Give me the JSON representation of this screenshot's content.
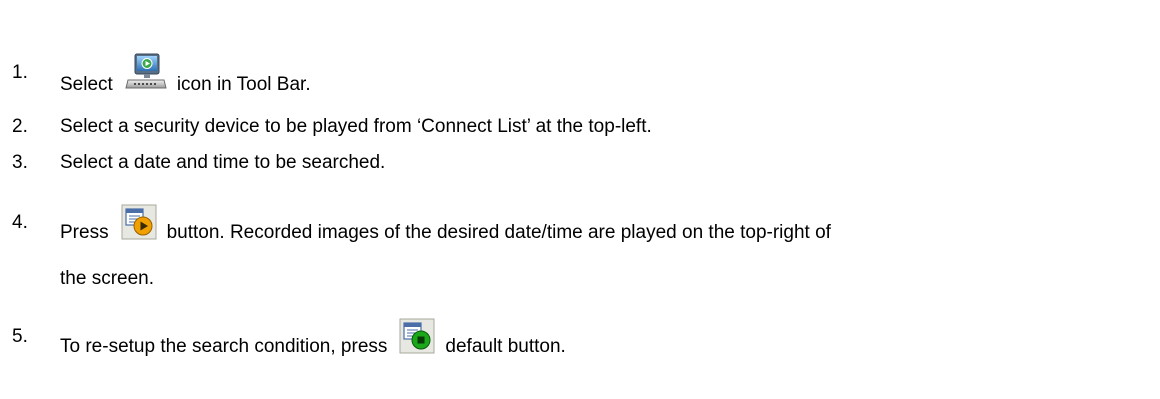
{
  "steps": [
    {
      "number": "1.",
      "before": "Select",
      "icon": "remote-playback-monitor-icon",
      "after": "icon in Tool Bar."
    },
    {
      "number": "2.",
      "text": "Select a security device to be played from ‘Connect List’ at the top-left."
    },
    {
      "number": "3.",
      "text": "Select a date and time to be searched."
    },
    {
      "number": "4.",
      "before": "Press",
      "icon": "search-play-button-icon",
      "after": "button. Recorded images of the desired date/time are played on the top-right of",
      "continuation": "the screen."
    },
    {
      "number": "5.",
      "before": "To re-setup the search condition, press",
      "icon": "search-default-button-icon",
      "after": "default button."
    }
  ],
  "colors": {
    "text": "#000000",
    "play_orange": "#f0a000",
    "default_green": "#1aa81a",
    "monitor_blue": "#2b6fb5"
  }
}
